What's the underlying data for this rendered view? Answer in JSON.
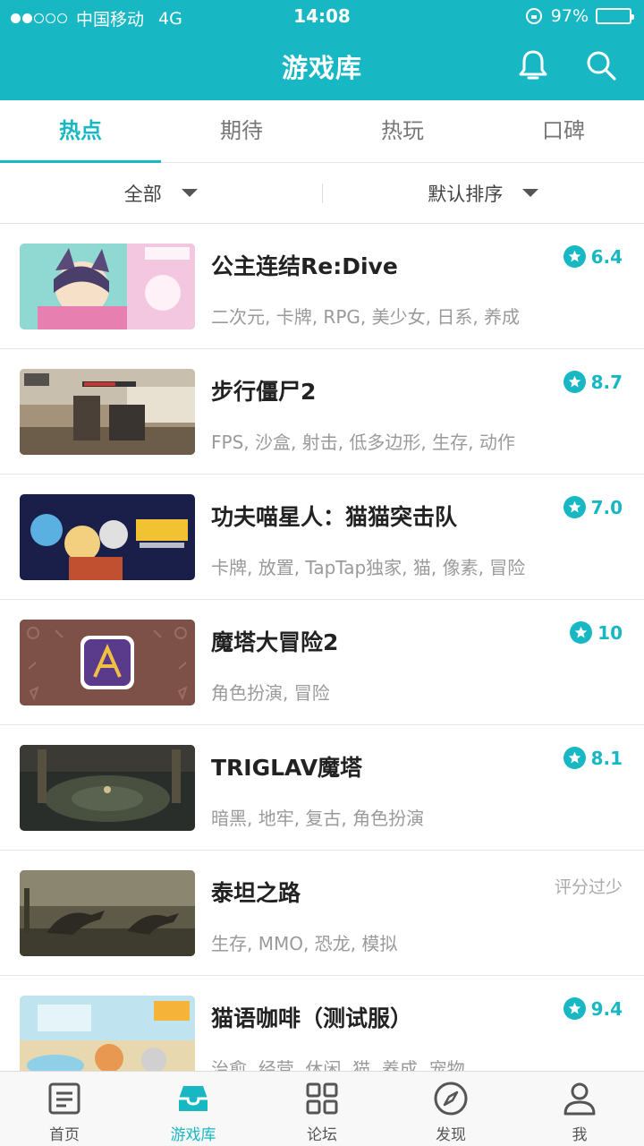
{
  "status_bar": {
    "carrier": "中国移动",
    "network": "4G",
    "time": "14:08",
    "battery": "97%",
    "battery_level": 0.97
  },
  "header": {
    "title": "游戏库",
    "bg_color": "#17b7c4"
  },
  "tabs": [
    {
      "label": "热点",
      "active": true
    },
    {
      "label": "期待",
      "active": false
    },
    {
      "label": "热玩",
      "active": false
    },
    {
      "label": "口碑",
      "active": false
    }
  ],
  "filters": {
    "category": "全部",
    "sort": "默认排序"
  },
  "games": [
    {
      "name": "公主连结Re:Dive",
      "tags": "二次元, 卡牌, RPG, 美少女, 日系, 养成",
      "rating": "6.4"
    },
    {
      "name": "步行僵尸2",
      "tags": "FPS, 沙盒, 射击, 低多边形, 生存, 动作",
      "rating": "8.7"
    },
    {
      "name": "功夫喵星人：猫猫突击队",
      "tags": "卡牌, 放置, TapTap独家, 猫, 像素, 冒险",
      "rating": "7.0"
    },
    {
      "name": "魔塔大冒险2",
      "tags": "角色扮演, 冒险",
      "rating": "10"
    },
    {
      "name": "TRIGLAV魔塔",
      "tags": "暗黑, 地牢, 复古, 角色扮演",
      "rating": "8.1"
    },
    {
      "name": "泰坦之路",
      "tags": "生存, MMO, 恐龙, 模拟",
      "rating_text": "评分过少"
    },
    {
      "name": "猫语咖啡（测试服）",
      "tags": "治愈, 经营, 休闲, 猫, 养成, 宠物",
      "rating": "9.4"
    }
  ],
  "tabbar": [
    {
      "label": "首页",
      "icon": "home-doc-icon",
      "active": false
    },
    {
      "label": "游戏库",
      "icon": "game-library-icon",
      "active": true
    },
    {
      "label": "论坛",
      "icon": "grid-forum-icon",
      "active": false
    },
    {
      "label": "发现",
      "icon": "compass-icon",
      "active": false
    },
    {
      "label": "我",
      "icon": "person-icon",
      "active": false
    }
  ],
  "colors": {
    "accent": "#17b7c4",
    "text": "#222222",
    "muted": "#9a9a9a"
  }
}
